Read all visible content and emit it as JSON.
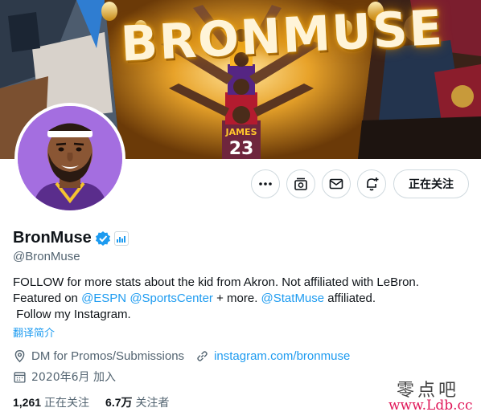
{
  "banner": {
    "title": "BRONMUSE",
    "jersey_number": "23",
    "jersey_name": "JAMES",
    "alt": "BronMuse header banner"
  },
  "avatar": {
    "alt": "BronMuse avatar"
  },
  "actions": {
    "more_icon": "more-icon",
    "subscribe_icon": "subscribe-icon",
    "message_icon": "mail-icon",
    "notify_icon": "notification-add-icon",
    "follow_label": "正在关注"
  },
  "profile": {
    "display_name": "BronMuse",
    "handle": "@BronMuse",
    "bio_line1": "FOLLOW for more stats about the kid from Akron. Not affiliated with LeBron.",
    "bio_line2_prefix": "Featured on ",
    "mention_espn": "@ESPN",
    "mention_sportscenter": "@SportsCenter",
    "bio_line2_middle": " + more. ",
    "mention_statmuse": "@StatMuse",
    "bio_line2_suffix": " affiliated.",
    "bio_line3": " Follow my Instagram.",
    "translate_label": "翻译简介",
    "location": "DM for Promos/Submissions",
    "website": "instagram.com/bronmuse",
    "joined": "2020年6月 加入"
  },
  "stats": {
    "following_count": "1,261",
    "following_label": "正在关注",
    "followers_count": "6.7万",
    "followers_label": "关注者"
  },
  "watermark": {
    "text_cn": "零点吧",
    "url": "www.Ldb.cc"
  },
  "colors": {
    "accent": "#1d9bf0",
    "secondary_text": "#536471",
    "border": "#cfd9de",
    "avatar_bg": "#a46ee0",
    "lakers_purple": "#552583",
    "lakers_gold": "#fdb927",
    "cavs_wine": "#6f263d"
  }
}
